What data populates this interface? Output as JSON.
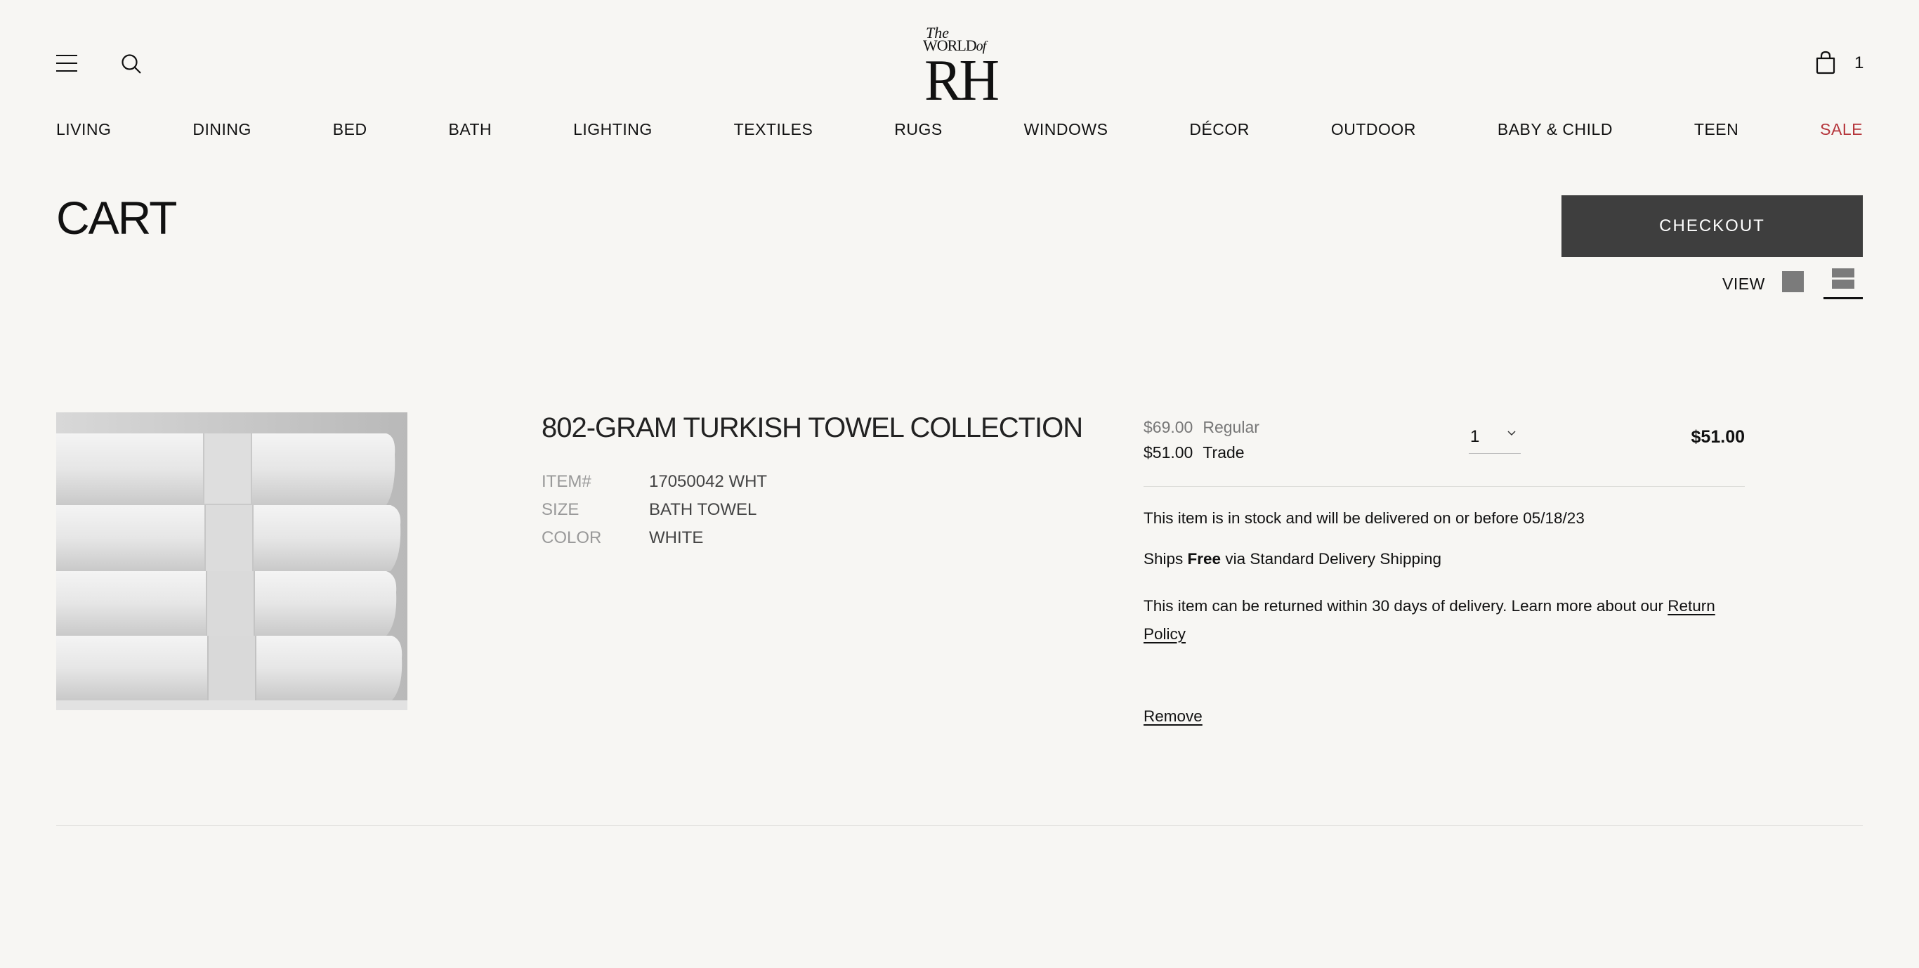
{
  "header": {
    "logo": {
      "line1": "The",
      "line2": "WORLD",
      "line2_suffix": "of",
      "line3": "RH"
    },
    "cart_count": "1",
    "icons": [
      "menu-icon",
      "search-icon",
      "shopping-bag-icon"
    ]
  },
  "nav": {
    "items": [
      {
        "label": "LIVING"
      },
      {
        "label": "DINING"
      },
      {
        "label": "BED"
      },
      {
        "label": "BATH"
      },
      {
        "label": "LIGHTING"
      },
      {
        "label": "TEXTILES"
      },
      {
        "label": "RUGS"
      },
      {
        "label": "WINDOWS"
      },
      {
        "label": "DÉCOR"
      },
      {
        "label": "OUTDOOR"
      },
      {
        "label": "BABY & CHILD"
      },
      {
        "label": "TEEN"
      },
      {
        "label": "SALE"
      }
    ],
    "sale_color": "#b5353b"
  },
  "cart": {
    "title": "CART",
    "checkout_label": "CHECKOUT",
    "view_label": "VIEW"
  },
  "item": {
    "title": "802-GRAM TURKISH TOWEL COLLECTION",
    "details": [
      {
        "label": "ITEM#",
        "value": "17050042 WHT"
      },
      {
        "label": "SIZE",
        "value": "BATH TOWEL"
      },
      {
        "label": "COLOR",
        "value": "WHITE"
      }
    ],
    "regular_price": "$69.00",
    "regular_label": "Regular",
    "trade_price": "$51.00",
    "trade_label": "Trade",
    "quantity": "1",
    "line_total": "$51.00",
    "stock_message": "This item is in stock and will be delivered on or before 05/18/23",
    "ships_prefix": "Ships ",
    "ships_free": "Free",
    "ships_suffix": " via Standard Delivery Shipping",
    "return_text": "This item can be returned within 30 days of delivery. Learn more about our ",
    "return_link": "Return Policy",
    "remove_label": "Remove"
  },
  "colors": {
    "background": "#f7f6f3",
    "checkout_bg": "#3e3e3e",
    "text": "#111111"
  }
}
